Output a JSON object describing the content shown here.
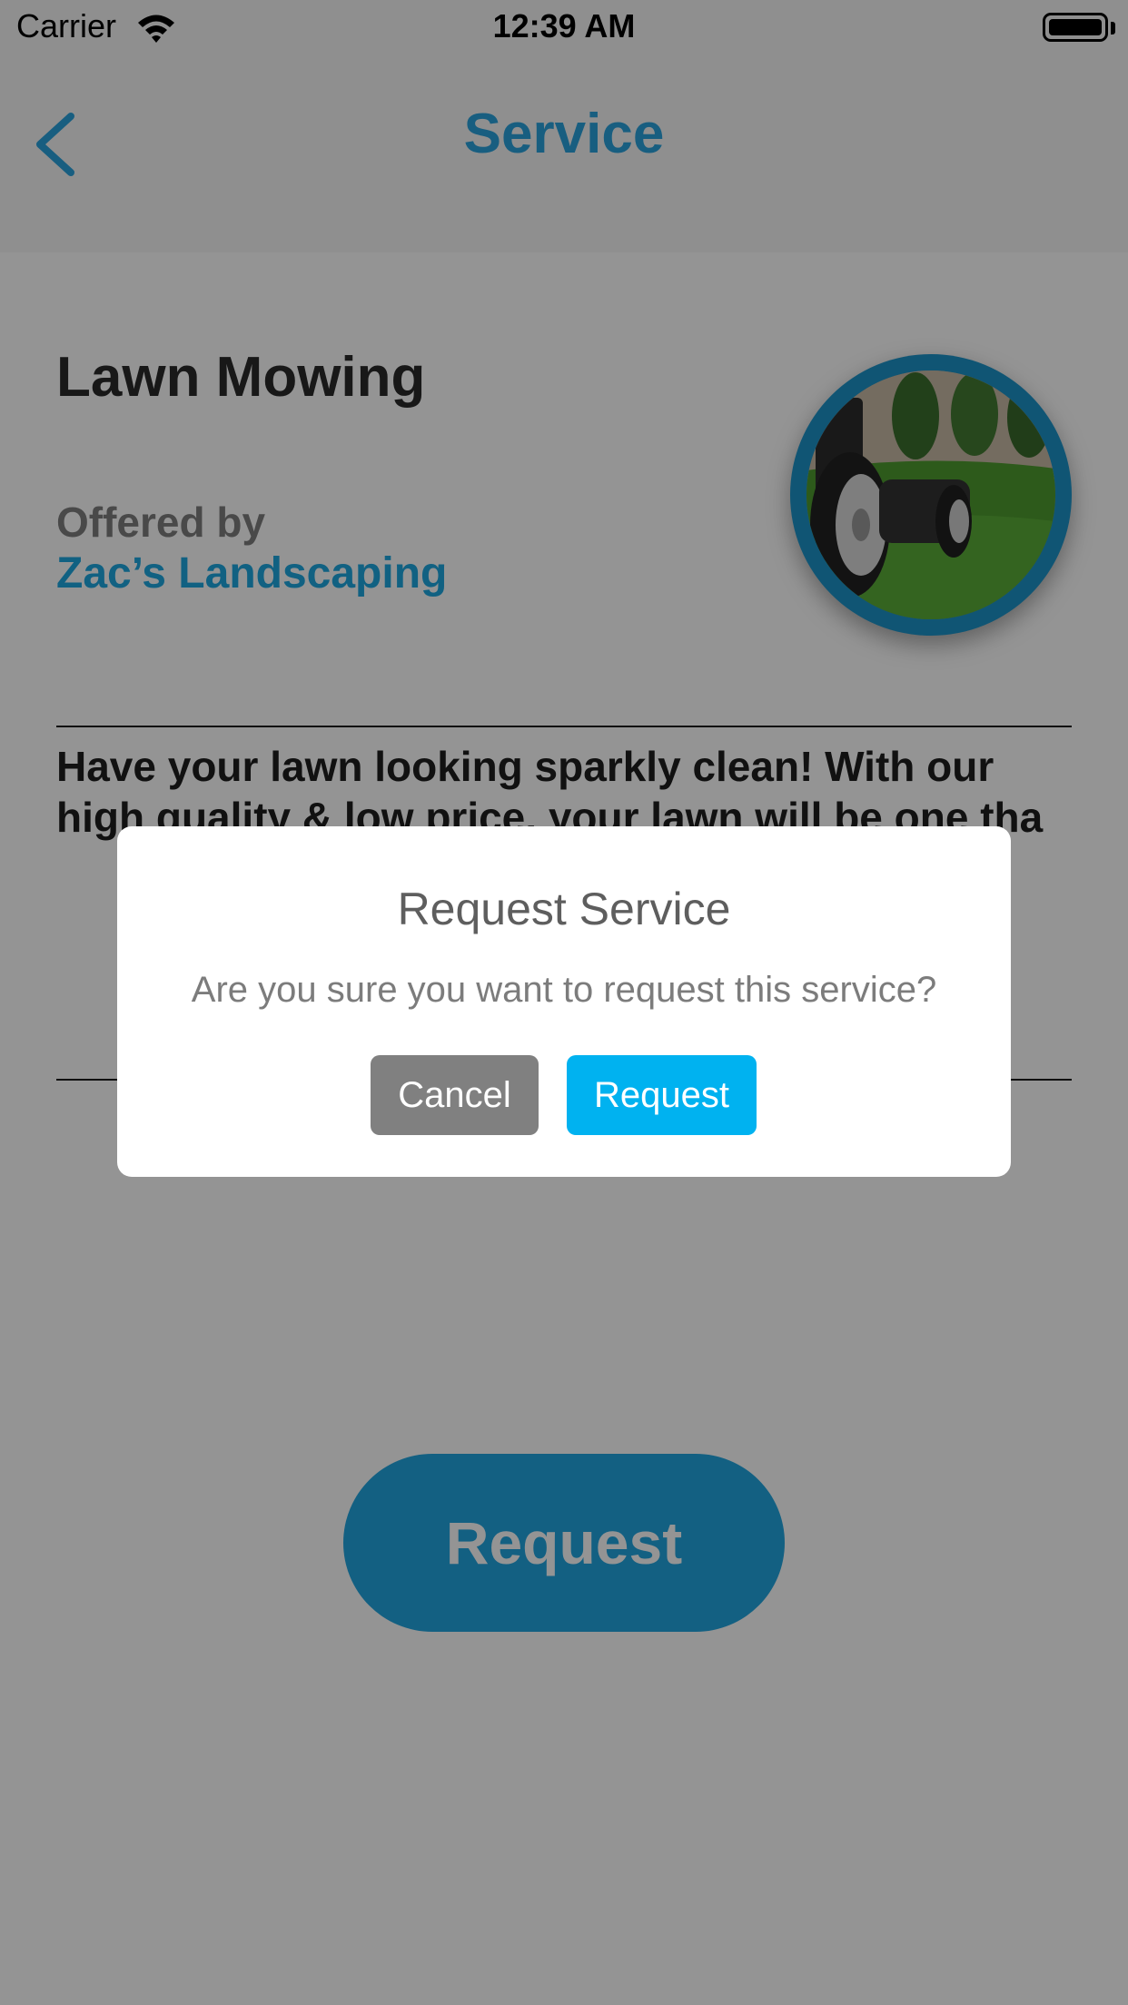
{
  "status_bar": {
    "carrier": "Carrier",
    "time": "12:39 AM"
  },
  "nav": {
    "title": "Service",
    "back_icon": "chevron-left-icon"
  },
  "service": {
    "name": "Lawn Mowing",
    "offered_by_label": "Offered by",
    "provider": "Zac’s Landscaping",
    "photo": "lawn-mower-photo",
    "description": "Have your lawn looking sparkly clean! With our high quality & low price, your lawn will be one tha"
  },
  "main_button": {
    "label": "Request"
  },
  "alert": {
    "title": "Request Service",
    "message": "Are you sure you want to request this service?",
    "cancel_label": "Cancel",
    "confirm_label": "Request"
  },
  "colors": {
    "accent": "#1ea7e1",
    "confirm": "#00b2f0",
    "cancel": "#808080",
    "overlay": "rgba(0,0,0,0.42)"
  }
}
